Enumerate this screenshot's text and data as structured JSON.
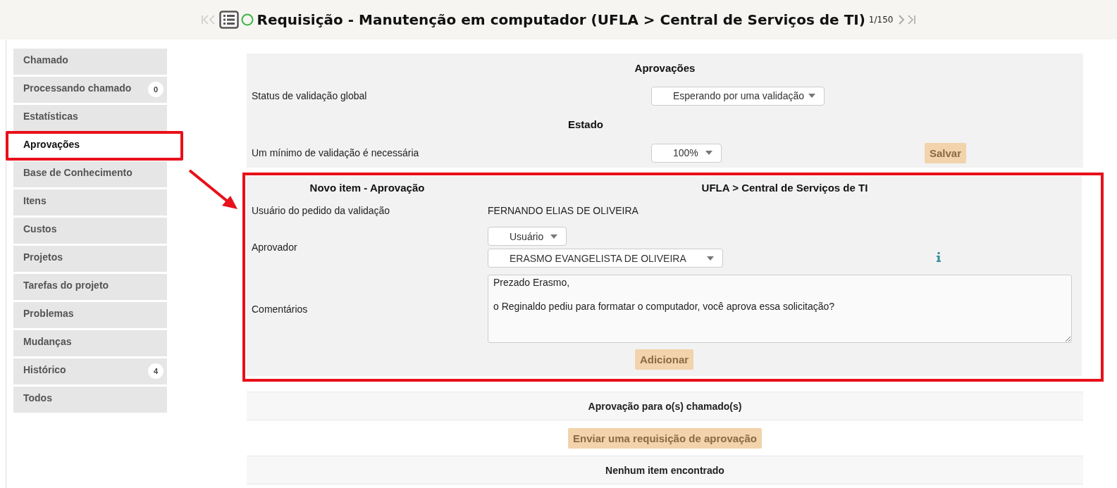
{
  "header": {
    "title": "Requisição - Manutenção em computador (UFLA > Central de Serviços de TI)",
    "counter": "1/150"
  },
  "sidebar": {
    "items": [
      {
        "label": "Chamado",
        "selected": false
      },
      {
        "label": "Processando chamado",
        "badge": "0",
        "selected": false
      },
      {
        "label": "Estatísticas",
        "selected": false
      },
      {
        "label": "Aprovações",
        "selected": true
      },
      {
        "label": "Base de Conhecimento",
        "selected": false
      },
      {
        "label": "Itens",
        "selected": false
      },
      {
        "label": "Custos",
        "selected": false
      },
      {
        "label": "Projetos",
        "selected": false
      },
      {
        "label": "Tarefas do projeto",
        "selected": false
      },
      {
        "label": "Problemas",
        "selected": false
      },
      {
        "label": "Mudanças",
        "selected": false
      },
      {
        "label": "Histórico",
        "badge": "4",
        "selected": false
      },
      {
        "label": "Todos",
        "selected": false
      }
    ]
  },
  "approvals": {
    "title": "Aprovações",
    "global_status": {
      "label": "Status de validação global",
      "value": "Esperando por uma validação"
    },
    "state_title": "Estado",
    "minimum": {
      "label": "Um mínimo de validação é necessária",
      "value": "100%"
    },
    "save_button": "Salvar"
  },
  "new_item": {
    "title": "Novo item - Aprovação",
    "entity": "UFLA > Central de Serviços de TI",
    "requester": {
      "label": "Usuário do pedido da validação",
      "value": "FERNANDO ELIAS DE OLIVEIRA"
    },
    "approver": {
      "label": "Aprovador",
      "type": "Usuário",
      "user": "ERASMO EVANGELISTA DE OLIVEIRA"
    },
    "comments": {
      "label": "Comentários",
      "value": "Prezado Erasmo,\n\no Reginaldo pediu para formatar o computador, você aprova essa solicitação?"
    },
    "add_button": "Adicionar"
  },
  "requests": {
    "title": "Aprovação para o(s) chamado(s)",
    "send_button": "Enviar uma requisição de aprovação",
    "empty": "Nenhum item encontrado"
  }
}
